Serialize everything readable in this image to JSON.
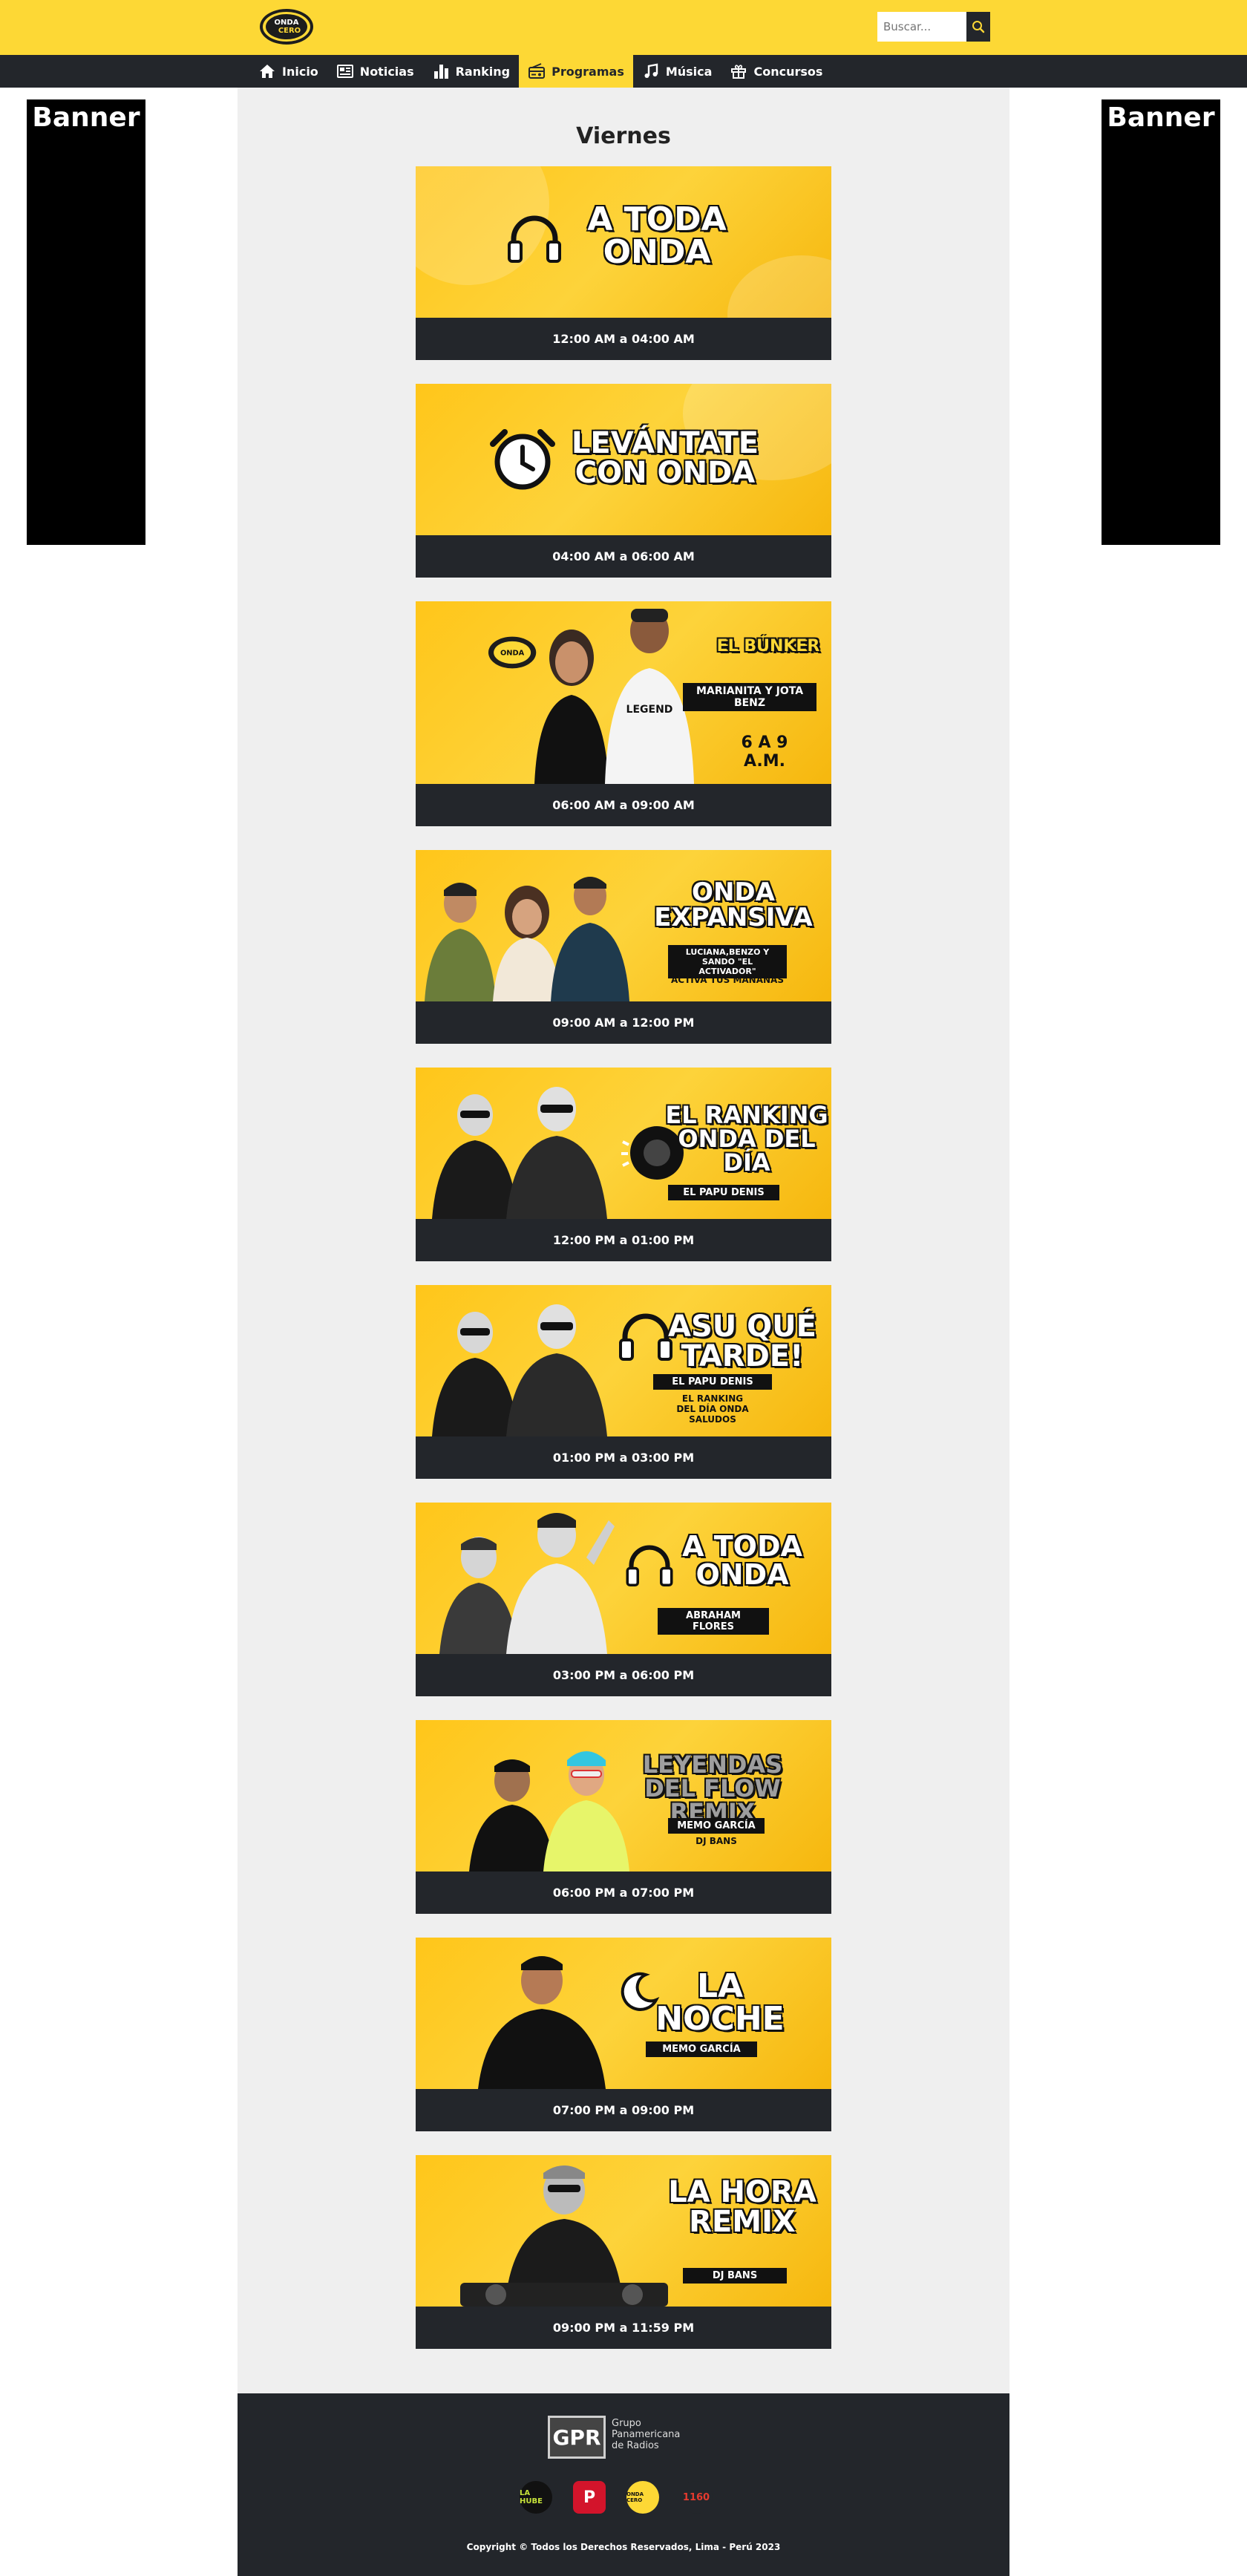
{
  "header": {
    "logo_text": "ONDA CERO",
    "search_placeholder": "Buscar..."
  },
  "nav": [
    {
      "label": "Inicio",
      "icon": "home-icon"
    },
    {
      "label": "Noticias",
      "icon": "newspaper-icon"
    },
    {
      "label": "Ranking",
      "icon": "bar-chart-icon"
    },
    {
      "label": "Programas",
      "icon": "radio-icon",
      "active": true
    },
    {
      "label": "Música",
      "icon": "music-icon"
    },
    {
      "label": "Concursos",
      "icon": "gift-icon"
    }
  ],
  "banners": {
    "left": "Banner",
    "right": "Banner"
  },
  "main": {
    "day_title": "Viernes",
    "programs": [
      {
        "title": "A TODA ONDA",
        "hosts": "",
        "extra": "",
        "time": "12:00 AM a 04:00 AM"
      },
      {
        "title": "LEVÁNTATE CON ONDA",
        "hosts": "",
        "extra": "",
        "time": "04:00 AM a 06:00 AM"
      },
      {
        "title": "EL BÚNKER",
        "hosts": "MARIANITA Y JOTA BENZ",
        "extra": "6 A 9 A.M.",
        "time": "06:00 AM a 09:00 AM"
      },
      {
        "title": "ONDA EXPANSIVA",
        "hosts": "LUCIANA,BENZO Y SANDO \"EL ACTIVADOR\"",
        "extra": "ACTIVA TUS MAÑANAS",
        "time": "09:00 AM a 12:00 PM"
      },
      {
        "title": "EL RANKING ONDA DEL DÍA",
        "hosts": "EL PAPU DENIS",
        "extra": "",
        "time": "12:00 PM a 01:00 PM"
      },
      {
        "title": "ASU QUÉ TARDE!",
        "hosts": "EL PAPU DENIS",
        "extra": "EL RANKING DEL DÍA ONDA SALUDOS",
        "time": "01:00 PM a 03:00 PM"
      },
      {
        "title": "A TODA ONDA",
        "hosts": "ABRAHAM FLORES",
        "extra": "",
        "time": "03:00 PM a 06:00 PM"
      },
      {
        "title": "LEYENDAS DEL FLOW REMIX",
        "hosts": "MEMO GARCÍA",
        "extra": "DJ BANS",
        "time": "06:00 PM a 07:00 PM"
      },
      {
        "title": "LA NOCHE",
        "hosts": "MEMO GARCÍA",
        "extra": "",
        "time": "07:00 PM a 09:00 PM"
      },
      {
        "title": "LA HORA REMIX",
        "hosts": "DJ BANS",
        "extra": "",
        "time": "09:00 PM a 11:59 PM"
      }
    ]
  },
  "footer": {
    "gpr_mark": "GPR",
    "gpr_name": [
      "Grupo",
      "Panamericana",
      "de Radios"
    ],
    "radios": [
      "LA HUBE",
      "P",
      "ONDA CERO",
      "1160"
    ],
    "copyright": "Copyright © Todos los Derechos Reservados, Lima - Perú 2023"
  },
  "colors": {
    "brand_yellow": "#fdd835",
    "dark": "#23262b",
    "panel": "#efefef"
  }
}
